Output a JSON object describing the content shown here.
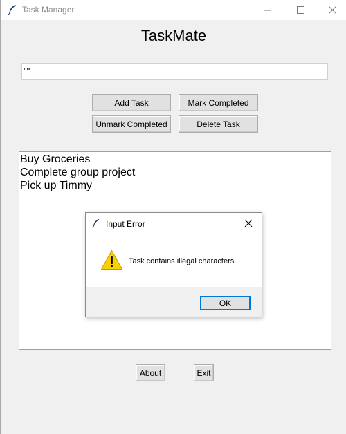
{
  "window": {
    "title": "Task Manager"
  },
  "app": {
    "heading": "TaskMate",
    "task_input_value": "\"\"",
    "buttons": {
      "add": "Add Task",
      "mark": "Mark Completed",
      "unmark": "Unmark Completed",
      "delete": "Delete Task",
      "about": "About",
      "exit": "Exit"
    },
    "tasks": [
      "Buy Groceries",
      "Complete group project",
      "Pick up Timmy"
    ]
  },
  "dialog": {
    "title": "Input Error",
    "message": "Task contains illegal characters.",
    "ok_label": "OK",
    "icon": "warning-icon"
  },
  "colors": {
    "window_bg": "#f0f0f0",
    "focus_border": "#0078d7",
    "warning_fill": "#fccf00"
  }
}
